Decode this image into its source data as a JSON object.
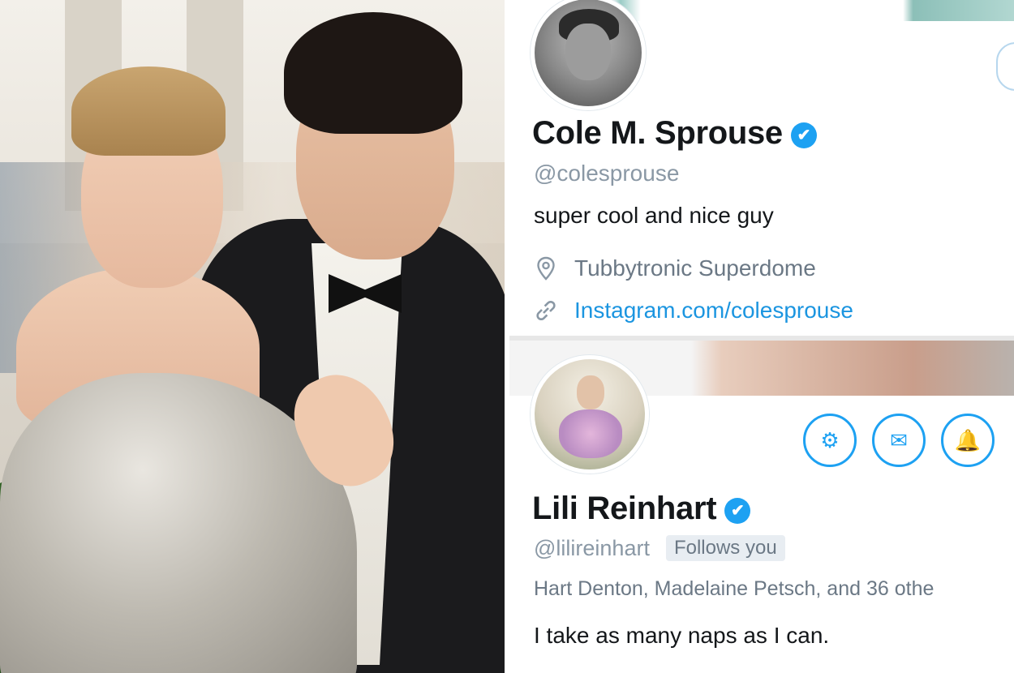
{
  "profiles": [
    {
      "name": "Cole M. Sprouse",
      "handle": "@colesprouse",
      "bio": "super cool and nice guy",
      "location": "Tubbytronic Superdome",
      "website": "Instagram.com/colesprouse",
      "verified": true
    },
    {
      "name": "Lili Reinhart",
      "handle": "@lilireinhart",
      "follows_you_badge": "Follows you",
      "followers_you_know": "Hart Denton, Madelaine Petsch, and 36 othe",
      "bio": "I take as many naps as I can.",
      "verified": true
    }
  ],
  "icons": {
    "verified": "verified-checkmark-icon",
    "location": "location-pin-icon",
    "link": "link-icon",
    "settings": "gear-icon",
    "message": "envelope-icon",
    "notifications": "bell-plus-icon"
  },
  "colors": {
    "twitter_blue": "#1da1f2",
    "link_blue": "#1b95e0",
    "secondary_text": "#8a98a5",
    "primary_text": "#14171a"
  }
}
